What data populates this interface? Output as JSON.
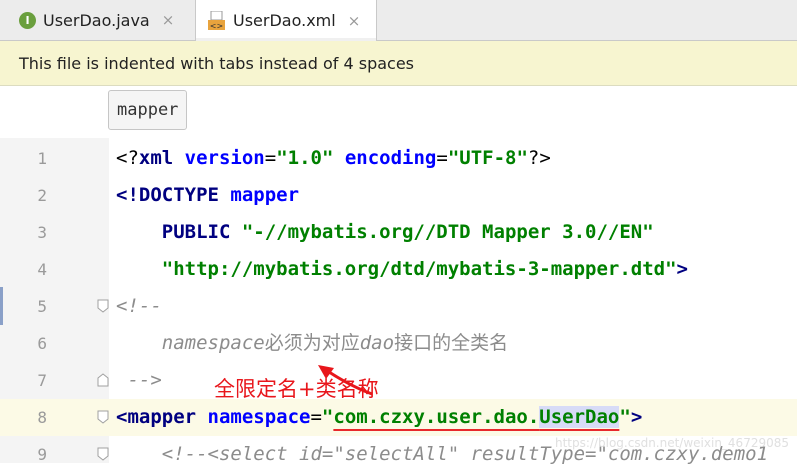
{
  "tabs": [
    {
      "label": "UserDao.java",
      "icon": "interface-icon",
      "icon_letter": "I",
      "close": "×",
      "active": false
    },
    {
      "label": "UserDao.xml",
      "icon": "xml-file-icon",
      "close": "×",
      "active": true
    }
  ],
  "notice": "This file is indented with tabs instead of 4 spaces",
  "breadcrumb": "mapper",
  "lines": [
    {
      "num": "1",
      "content": "<?xml version=\"1.0\" encoding=\"UTF-8\"?>"
    },
    {
      "num": "2",
      "content": "<!DOCTYPE mapper"
    },
    {
      "num": "3",
      "content": "PUBLIC \"-//mybatis.org//DTD Mapper 3.0//EN\""
    },
    {
      "num": "4",
      "content": "\"http://mybatis.org/dtd/mybatis-3-mapper.dtd\">"
    },
    {
      "num": "5",
      "content": "<!--"
    },
    {
      "num": "6",
      "content": "namespace必须为对应dao接口的全类名"
    },
    {
      "num": "7",
      "content": "-->"
    },
    {
      "num": "8",
      "content": "<mapper namespace=\"com.czxy.user.dao.UserDao\">"
    },
    {
      "num": "9",
      "content": "<!--<select id=\"selectAll\" resultType=\"com.czxy.demo1"
    }
  ],
  "annotation": "全限定名+类名称",
  "watermark": "https://blog.csdn.net/weixin_46729085",
  "colors": {
    "tag": "#000080",
    "attr": "#0000ff",
    "string": "#008000",
    "comment": "#8c8c8c",
    "annotation": "#e8161b",
    "notice_bg": "#f7f5d0",
    "current_line": "#fcfae6"
  }
}
